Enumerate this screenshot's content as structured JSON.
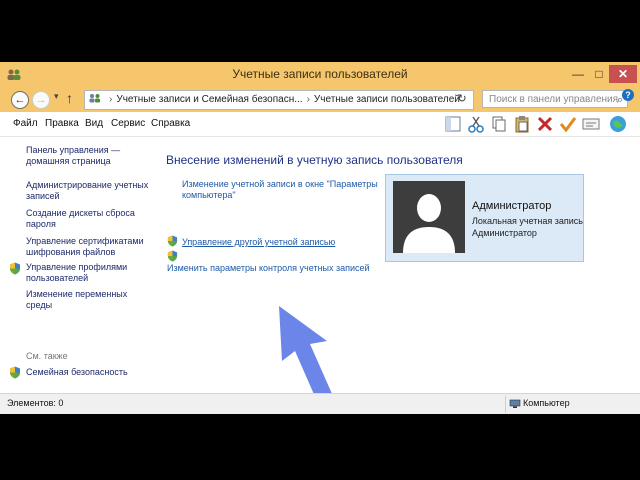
{
  "window": {
    "title": "Учетные записи пользователей",
    "buttons": {
      "minimize": "—",
      "maximize": "□",
      "close": "✕"
    }
  },
  "nav": {
    "address": [
      "Учетные записи и Семейная безопасн...",
      "Учетные записи пользователей"
    ],
    "search_placeholder": "Поиск в панели управления"
  },
  "menu": [
    "Файл",
    "Правка",
    "Вид",
    "Сервис",
    "Справка"
  ],
  "toolbar_icons": [
    "window-pane-icon",
    "cut-icon",
    "copy-icon",
    "paste-icon",
    "delete-icon",
    "check-icon",
    "properties-icon",
    "globe-icon"
  ],
  "sidebar": {
    "items": [
      "Панель управления —\nдомашняя страница",
      "Администрирование учетных\nзаписей",
      "Создание дискеты сброса\nпароля",
      "Управление сертификатами\nшифрования файлов",
      "Управление профилями\nпользователей",
      "Изменение переменных\nсреды"
    ],
    "see_also_label": "См. также",
    "see_also_items": [
      "Семейная безопасность"
    ]
  },
  "main": {
    "heading": "Внесение изменений в учетную запись пользователя",
    "links": [
      "Изменение учетной записи в окне \"Параметры\nкомпьютера\"",
      "Управление другой учетной записью",
      "Изменить параметры контроля учетных записей"
    ]
  },
  "account": {
    "name": "Администратор",
    "type": "Локальная учетная запись",
    "group": "Администратор"
  },
  "status": {
    "items_count": "Элементов: 0",
    "location": "Компьютер"
  },
  "colors": {
    "titlebar": "#f6c66c",
    "close_button": "#c75050",
    "heading": "#1e3287",
    "link": "#1e5aa8",
    "account_bg": "#dceaf7",
    "annotation_arrow": "#6b86e8"
  }
}
